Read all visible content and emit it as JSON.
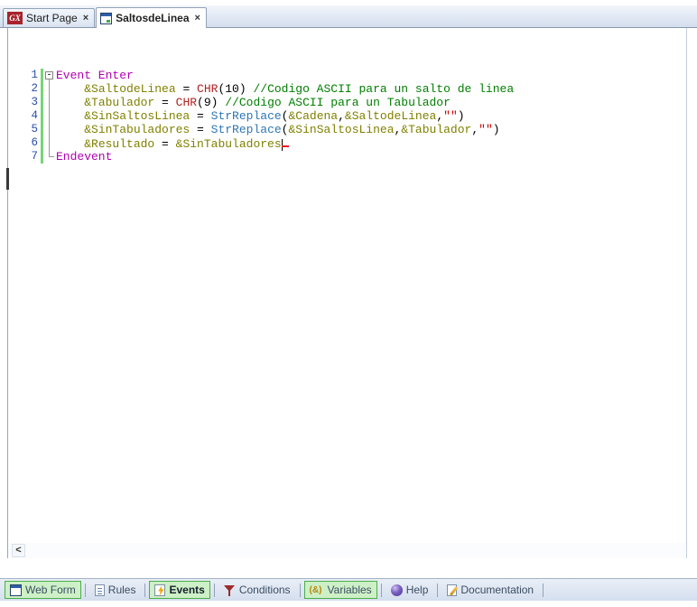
{
  "tabs": {
    "close_glyph": "×",
    "items": [
      {
        "id": "start-page",
        "label": "Start Page",
        "icon": "gx-logo-icon",
        "icon_text": "GX",
        "active": false
      },
      {
        "id": "saltosdelinea",
        "label": "SaltosdeLinea",
        "icon": "webpanel-icon",
        "active": true
      }
    ]
  },
  "editor": {
    "fold_glyph": "-",
    "scrollbar_left_arrow": "<",
    "lines": [
      {
        "n": "1",
        "fold": "start",
        "modified": true,
        "tokens": [
          {
            "c": "kw",
            "t": "Event Enter"
          }
        ]
      },
      {
        "n": "2",
        "fold": "line",
        "modified": true,
        "tokens": [
          {
            "c": "pl",
            "t": "    "
          },
          {
            "c": "var",
            "t": "&SaltodeLinea"
          },
          {
            "c": "pl",
            "t": " = "
          },
          {
            "c": "fnr",
            "t": "CHR"
          },
          {
            "c": "pl",
            "t": "(10) "
          },
          {
            "c": "com",
            "t": "//Codigo ASCII para un salto de linea"
          }
        ]
      },
      {
        "n": "3",
        "fold": "line",
        "modified": true,
        "tokens": [
          {
            "c": "pl",
            "t": "    "
          },
          {
            "c": "var",
            "t": "&Tabulador"
          },
          {
            "c": "pl",
            "t": " = "
          },
          {
            "c": "fnr",
            "t": "CHR"
          },
          {
            "c": "pl",
            "t": "(9) "
          },
          {
            "c": "com",
            "t": "//Codigo ASCII para un Tabulador"
          }
        ]
      },
      {
        "n": "4",
        "fold": "line",
        "modified": true,
        "tokens": [
          {
            "c": "pl",
            "t": "    "
          },
          {
            "c": "var",
            "t": "&SinSaltosLinea"
          },
          {
            "c": "pl",
            "t": " = "
          },
          {
            "c": "fnb",
            "t": "StrReplace"
          },
          {
            "c": "pl",
            "t": "("
          },
          {
            "c": "var",
            "t": "&Cadena"
          },
          {
            "c": "pl",
            "t": ","
          },
          {
            "c": "var",
            "t": "&SaltodeLinea"
          },
          {
            "c": "pl",
            "t": ","
          },
          {
            "c": "str",
            "t": "\"\""
          },
          {
            "c": "pl",
            "t": ")"
          }
        ]
      },
      {
        "n": "5",
        "fold": "line",
        "modified": true,
        "tokens": [
          {
            "c": "pl",
            "t": "    "
          },
          {
            "c": "var",
            "t": "&SinTabuladores"
          },
          {
            "c": "pl",
            "t": " = "
          },
          {
            "c": "fnb",
            "t": "StrReplace"
          },
          {
            "c": "pl",
            "t": "("
          },
          {
            "c": "var",
            "t": "&SinSaltosLinea"
          },
          {
            "c": "pl",
            "t": ","
          },
          {
            "c": "var",
            "t": "&Tabulador"
          },
          {
            "c": "pl",
            "t": ","
          },
          {
            "c": "str",
            "t": "\"\""
          },
          {
            "c": "pl",
            "t": ")"
          }
        ]
      },
      {
        "n": "6",
        "fold": "line",
        "modified": true,
        "caret": true,
        "tokens": [
          {
            "c": "pl",
            "t": "    "
          },
          {
            "c": "var",
            "t": "&Resultado"
          },
          {
            "c": "pl",
            "t": " = "
          },
          {
            "c": "var",
            "t": "&SinTabuladores"
          }
        ]
      },
      {
        "n": "7",
        "fold": "end",
        "modified": true,
        "tokens": [
          {
            "c": "kw",
            "t": "Endevent"
          }
        ]
      }
    ]
  },
  "parts": {
    "items": [
      {
        "id": "web-form",
        "label": "Web Form",
        "icon": "webform-icon",
        "highlight": true,
        "bold": false
      },
      {
        "id": "rules",
        "label": "Rules",
        "icon": "rules-icon",
        "highlight": false,
        "bold": false
      },
      {
        "id": "events",
        "label": "Events",
        "icon": "events-icon",
        "highlight": true,
        "bold": true
      },
      {
        "id": "conditions",
        "label": "Conditions",
        "icon": "conditions-icon",
        "highlight": false,
        "bold": false
      },
      {
        "id": "variables",
        "label": "Variables",
        "icon": "variables-icon",
        "highlight": true,
        "bold": false
      },
      {
        "id": "help",
        "label": "Help",
        "icon": "help-icon",
        "highlight": false,
        "bold": false
      },
      {
        "id": "documentation",
        "label": "Documentation",
        "icon": "documentation-icon",
        "highlight": false,
        "bold": false
      }
    ]
  },
  "colors": {
    "keyword": "#B000B0",
    "variable": "#808000",
    "function_red": "#B22222",
    "function_blue": "#2E75B6",
    "string": "#CC0000",
    "comment": "#007F00",
    "line_number": "#2B4FAF",
    "change_bar": "#77D577",
    "part_highlight_bg": "#CDF0C6",
    "part_highlight_border": "#4CAE4C",
    "gx_logo_bg": "#A8232D"
  }
}
